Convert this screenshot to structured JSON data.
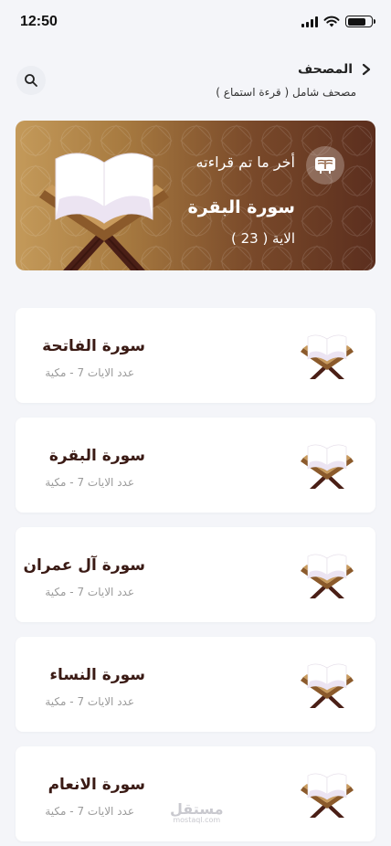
{
  "status_bar": {
    "time": "12:50"
  },
  "header": {
    "title": "المصحف",
    "subtitle": "مصحف شامل ( قرءة استماع )"
  },
  "hero": {
    "label": "أخر ما تم قراءته",
    "surah": "سورة البقرة",
    "ayah": "الاية ( 23 )"
  },
  "surahs": [
    {
      "name": "سورة الفاتحة",
      "meta": "عدد الايات 7 - مكية"
    },
    {
      "name": "سورة البقرة",
      "meta": "عدد الايات 7 - مكية"
    },
    {
      "name": "سورة آل عمران",
      "meta": "عدد الايات 7 - مكية"
    },
    {
      "name": "سورة النساء",
      "meta": "عدد الايات 7 - مكية"
    },
    {
      "name": "سورة الانعام",
      "meta": "عدد الايات 7 - مكية"
    }
  ],
  "watermark": {
    "text": "مستقل",
    "sub": "mostaql.com"
  },
  "colors": {
    "brown_dark": "#4a2518",
    "gold": "#b8874a",
    "bg": "#f4f5f9"
  },
  "icons": [
    "search-icon",
    "chevron-right-icon",
    "book-read-icon",
    "quran-stand-icon"
  ]
}
